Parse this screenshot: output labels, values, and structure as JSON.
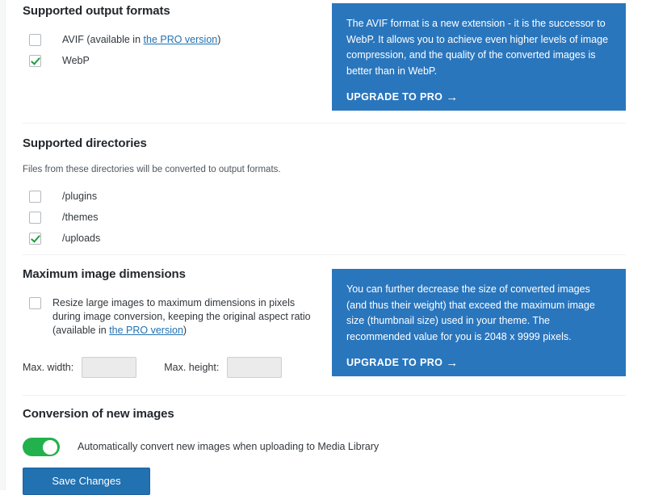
{
  "sections": {
    "output_formats": {
      "title": "Supported output formats",
      "options": [
        {
          "label_before": "AVIF (available in ",
          "link": "the PRO version",
          "label_after": ")",
          "checked": false
        },
        {
          "label_before": "WebP",
          "link": "",
          "label_after": "",
          "checked": true
        }
      ]
    },
    "directories": {
      "title": "Supported directories",
      "description": "Files from these directories will be converted to output formats.",
      "options": [
        {
          "label": "/plugins",
          "checked": false
        },
        {
          "label": "/themes",
          "checked": false
        },
        {
          "label": "/uploads",
          "checked": true
        }
      ]
    },
    "max_dimensions": {
      "title": "Maximum image dimensions",
      "resize_label_before": "Resize large images to maximum dimensions in pixels during image conversion, keeping the original aspect ratio (available in ",
      "resize_link": "the PRO version",
      "resize_label_after": ")",
      "resize_checked": false,
      "width_label": "Max. width:",
      "width_value": "",
      "width_placeholder": "",
      "height_label": "Max. height:",
      "height_value": "",
      "height_placeholder": ""
    },
    "conversion": {
      "title": "Conversion of new images",
      "toggle_label": "Automatically convert new images when uploading to Media Library",
      "toggle_on": true
    }
  },
  "promos": [
    {
      "body": "The AVIF format is a new extension - it is the successor to WebP. It allows you to achieve even higher levels of image compression, and the quality of the converted images is better than in WebP.",
      "cta": "UPGRADE TO PRO",
      "arrow": "→"
    },
    {
      "body": "You can further decrease the size of converted images (and thus their weight) that exceed the maximum image size (thumbnail size) used in your theme. The recommended value for you is 2048 x 9999 pixels.",
      "cta": "UPGRADE TO PRO",
      "arrow": "→"
    }
  ],
  "footer": {
    "save_label": "Save Changes"
  },
  "colors": {
    "promo_bg": "#2a76bd",
    "link": "#2271b1",
    "check": "#1e9e3e",
    "toggle_on": "#22b14c",
    "button": "#2271b1"
  }
}
